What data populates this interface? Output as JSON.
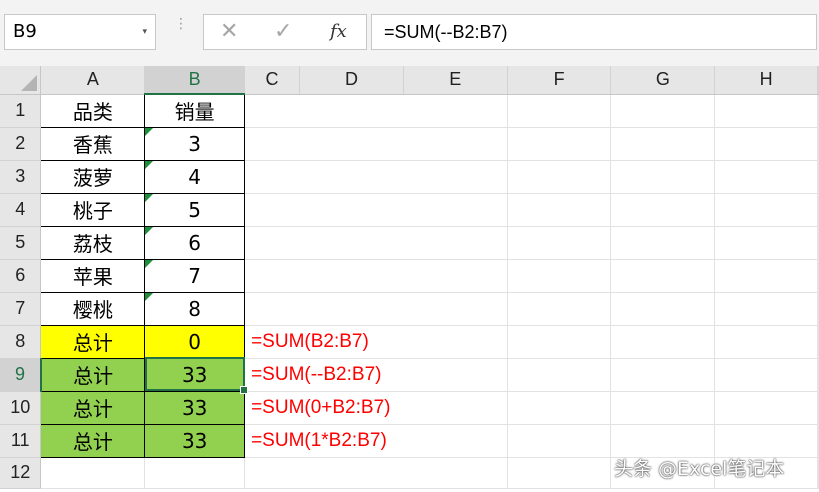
{
  "name_box": {
    "value": "B9",
    "arrow": "▾"
  },
  "formula_bar": {
    "separator": "⋮",
    "cancel_icon": "✕",
    "enter_icon": "✓",
    "fx_label": "fx",
    "formula": "=SUM(--B2:B7)"
  },
  "columns": [
    "A",
    "B",
    "C",
    "D",
    "E",
    "F",
    "G",
    "H"
  ],
  "selected_column": "B",
  "rows": [
    {
      "num": "1",
      "a": "品类",
      "b": "销量",
      "note": ""
    },
    {
      "num": "2",
      "a": "香蕉",
      "b": "3",
      "note": ""
    },
    {
      "num": "3",
      "a": "菠萝",
      "b": "4",
      "note": ""
    },
    {
      "num": "4",
      "a": "桃子",
      "b": "5",
      "note": ""
    },
    {
      "num": "5",
      "a": "荔枝",
      "b": "6",
      "note": ""
    },
    {
      "num": "6",
      "a": "苹果",
      "b": "7",
      "note": ""
    },
    {
      "num": "7",
      "a": "樱桃",
      "b": "8",
      "note": ""
    },
    {
      "num": "8",
      "a": "总计",
      "b": "0",
      "note": "=SUM(B2:B7)"
    },
    {
      "num": "9",
      "a": "总计",
      "b": "33",
      "note": "=SUM(--B2:B7)"
    },
    {
      "num": "10",
      "a": "总计",
      "b": "33",
      "note": "=SUM(0+B2:B7)"
    },
    {
      "num": "11",
      "a": "总计",
      "b": "33",
      "note": "=SUM(1*B2:B7)"
    },
    {
      "num": "12",
      "a": "",
      "b": "",
      "note": ""
    }
  ],
  "selected_row": "9",
  "colors": {
    "highlight_yellow": "#ffff00",
    "highlight_green": "#92d050",
    "formula_note": "#ff0000",
    "selection": "#217346"
  },
  "watermark": "头条 @Excel笔记本"
}
